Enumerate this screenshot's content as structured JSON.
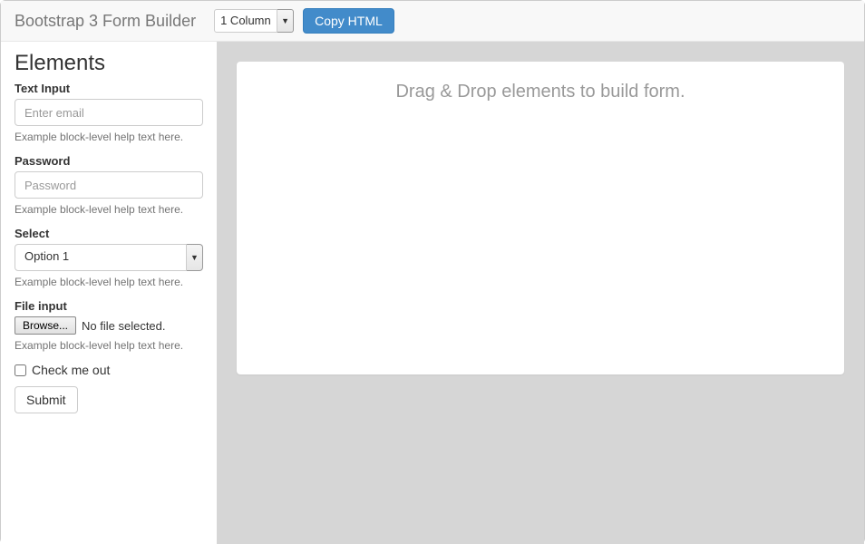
{
  "navbar": {
    "brand": "Bootstrap 3 Form Builder",
    "columnSelect": "1 Column",
    "copyButton": "Copy HTML"
  },
  "sidebar": {
    "title": "Elements",
    "textInput": {
      "label": "Text Input",
      "placeholder": "Enter email",
      "help": "Example block-level help text here."
    },
    "password": {
      "label": "Password",
      "placeholder": "Password",
      "help": "Example block-level help text here."
    },
    "select": {
      "label": "Select",
      "value": "Option 1",
      "help": "Example block-level help text here."
    },
    "fileInput": {
      "label": "File input",
      "browse": "Browse...",
      "noFile": "No file selected.",
      "help": "Example block-level help text here."
    },
    "checkbox": {
      "label": "Check me out"
    },
    "submit": "Submit"
  },
  "canvas": {
    "placeholder": "Drag & Drop elements to build form."
  }
}
